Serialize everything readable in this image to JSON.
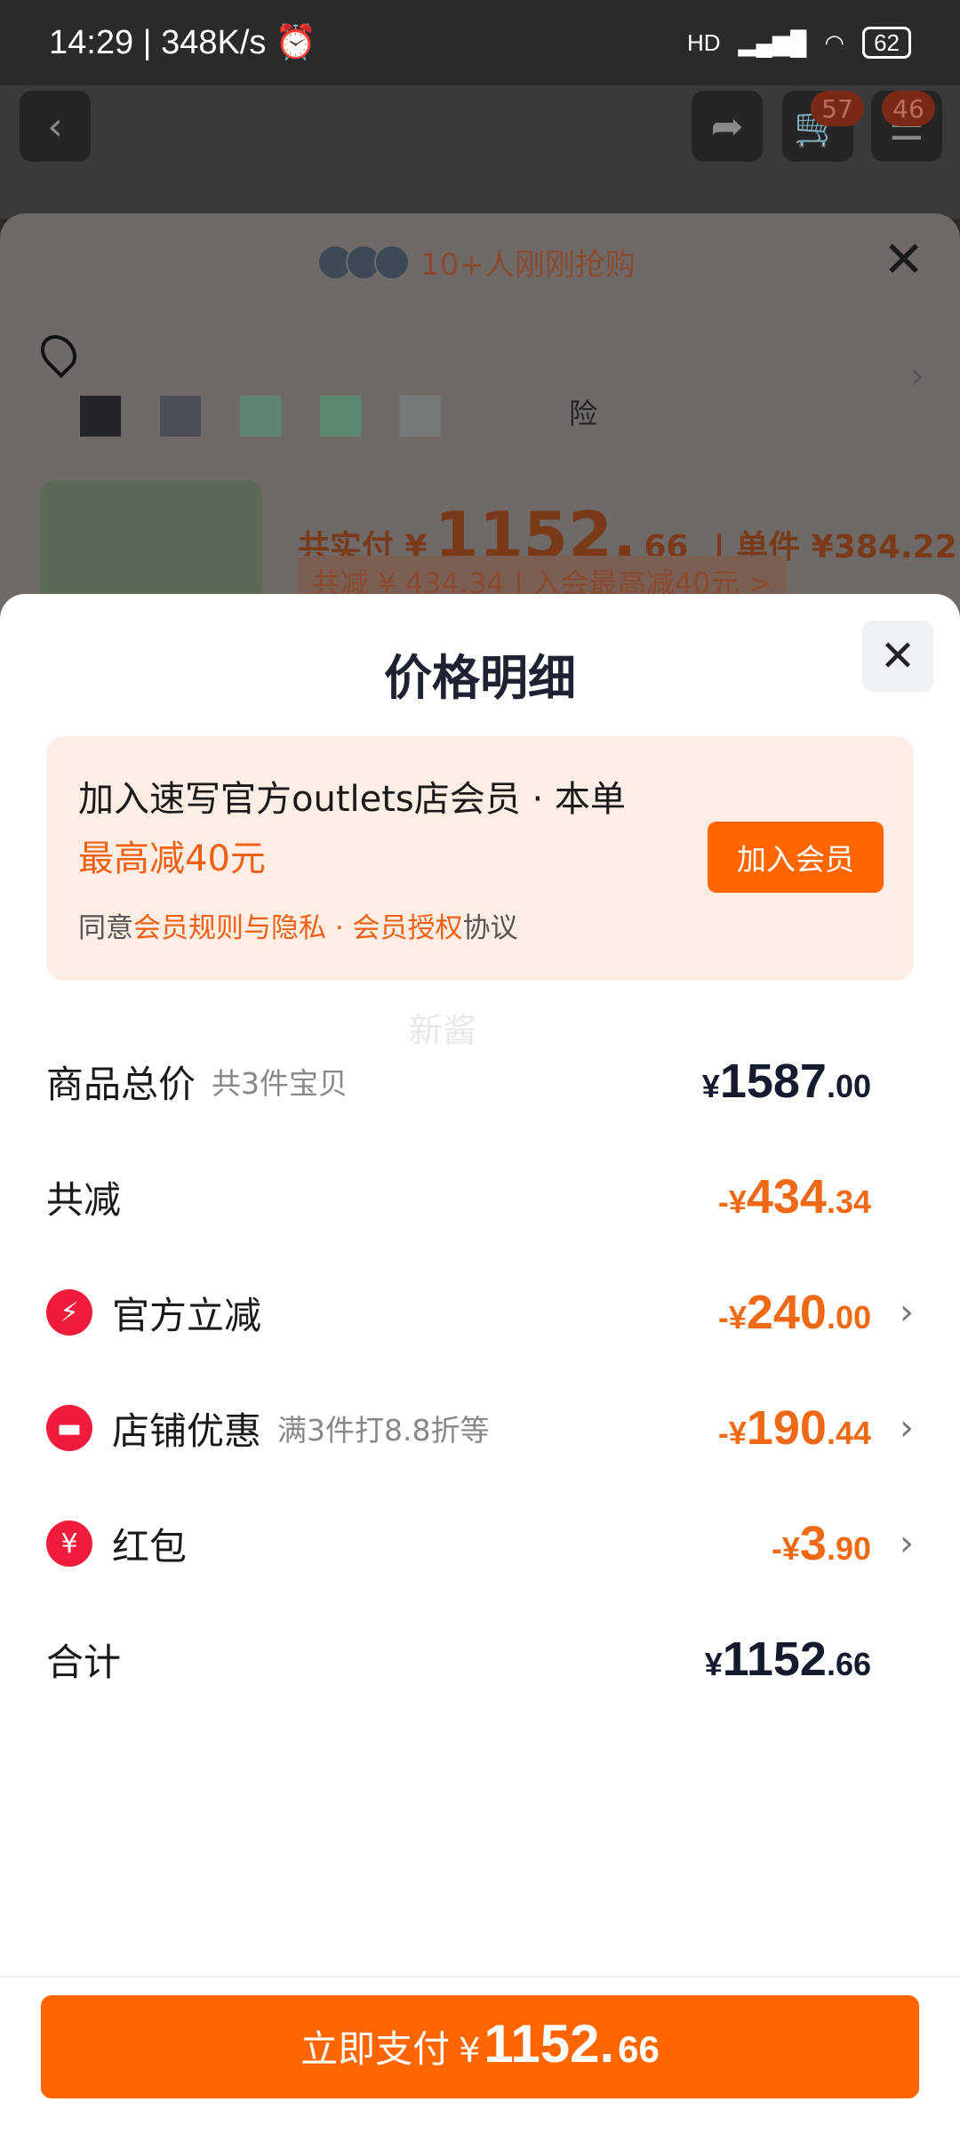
{
  "status_bar": {
    "time": "14:29",
    "speed": "348K/s",
    "network": "HD",
    "battery": "62"
  },
  "top_nav": {
    "cart_badge": "57",
    "msg_badge": "46"
  },
  "background_sheet": {
    "buyers_text": "10+人刚刚抢购",
    "insurance_text": "险",
    "total_label": "共实付 ¥",
    "total_int": "1152.",
    "total_dec": "66",
    "unit_text": "| 单件 ¥384.22",
    "savings_text": "共减 ¥ 434.34 | 入会最高减40元 >"
  },
  "sheet": {
    "title": "价格明细"
  },
  "member": {
    "line1": "加入速写官方outlets店会员 · 本单",
    "line2": "最高减40元",
    "agree_prefix": "同意",
    "agree_link": "会员规则与隐私 · 会员授权",
    "agree_suffix": "协议",
    "join_label": "加入会员"
  },
  "watermark": "新酱",
  "rows": {
    "goods": {
      "label": "商品总价",
      "sub": "共3件宝贝",
      "cur": "¥",
      "int": "1587",
      "dec": ".00"
    },
    "reduce": {
      "label": "共减",
      "cur": "-¥",
      "int": "434",
      "dec": ".34"
    },
    "official": {
      "label": "官方立减",
      "cur": "-¥",
      "int": "240",
      "dec": ".00"
    },
    "shop": {
      "label": "店铺优惠",
      "sub": "满3件打8.8折等",
      "cur": "-¥",
      "int": "190",
      "dec": ".44"
    },
    "redpacket": {
      "label": "红包",
      "cur": "-¥",
      "int": "3",
      "dec": ".90"
    },
    "total": {
      "label": "合计",
      "cur": "¥",
      "int": "1152",
      "dec": ".66"
    }
  },
  "footer": {
    "pay_label": "立即支付",
    "cur": "¥",
    "int": "1152.",
    "dec": "66"
  },
  "colors": {
    "accent": "#ff6600",
    "discount": "#f06a15",
    "icon_red": "#f21b3c"
  },
  "icons": {
    "official": "lightning-icon",
    "shop": "shop-icon",
    "redpacket": "red-packet-icon"
  }
}
